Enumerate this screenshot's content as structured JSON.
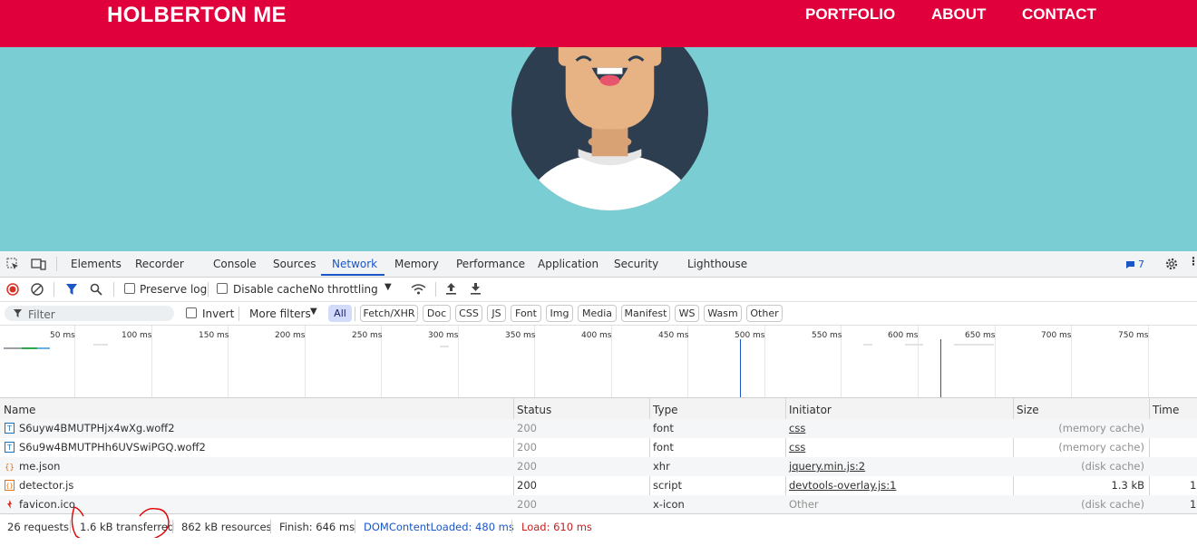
{
  "site": {
    "brand": "HOLBERTON ME",
    "nav": [
      "PORTFOLIO",
      "ABOUT",
      "CONTACT"
    ]
  },
  "colors": {
    "header": "#e0003c",
    "hero": "#7acdd2",
    "avatar_bg": "#2d3e50",
    "accent": "#1a56c7"
  },
  "devtools": {
    "tabs": [
      "Elements",
      "Recorder",
      "Console",
      "Sources",
      "Network",
      "Memory",
      "Performance",
      "Application",
      "Security",
      "Lighthouse"
    ],
    "active_tab": "Network",
    "issues_count": "7",
    "toolbar": {
      "preserve_log": "Preserve log",
      "disable_cache": "Disable cache",
      "throttling": "No throttling"
    },
    "filter": {
      "placeholder": "Filter",
      "invert": "Invert",
      "more_filters": "More filters",
      "types": [
        "All",
        "Fetch/XHR",
        "Doc",
        "CSS",
        "JS",
        "Font",
        "Img",
        "Media",
        "Manifest",
        "WS",
        "Wasm",
        "Other"
      ]
    },
    "overview_ticks": [
      "50 ms",
      "100 ms",
      "150 ms",
      "200 ms",
      "250 ms",
      "300 ms",
      "350 ms",
      "400 ms",
      "450 ms",
      "500 ms",
      "550 ms",
      "600 ms",
      "650 ms",
      "700 ms",
      "750 ms"
    ],
    "columns": [
      "Name",
      "Status",
      "Type",
      "Initiator",
      "Size",
      "Time"
    ],
    "rows": [
      {
        "name": "S6uyw4BMUTPHjx4wXg.woff2",
        "status": "200",
        "type": "font",
        "initiator": "css",
        "size": "(memory cache)",
        "time": "",
        "icon": "font-icon"
      },
      {
        "name": "S6u9w4BMUTPHh6UVSwiPGQ.woff2",
        "status": "200",
        "type": "font",
        "initiator": "css",
        "size": "(memory cache)",
        "time": "",
        "icon": "font-icon"
      },
      {
        "name": "me.json",
        "status": "200",
        "type": "xhr",
        "initiator": "jquery.min.js:2",
        "size": "(disk cache)",
        "time": "",
        "icon": "json-icon"
      },
      {
        "name": "detector.js",
        "status": "200",
        "type": "script",
        "initiator": "devtools-overlay.js:1",
        "size": "1.3 kB",
        "time": "1",
        "icon": "script-icon"
      },
      {
        "name": "favicon.ico",
        "status": "200",
        "type": "x-icon",
        "initiator": "Other",
        "size": "(disk cache)",
        "time": "1",
        "icon": "favicon-icon"
      }
    ],
    "status_bar": {
      "requests": "26 requests",
      "transferred": "1.6 kB transferred",
      "resources": "862 kB resources",
      "finish": "Finish: 646 ms",
      "dom_content_loaded": "DOMContentLoaded: 480 ms",
      "load": "Load: 610 ms"
    }
  }
}
